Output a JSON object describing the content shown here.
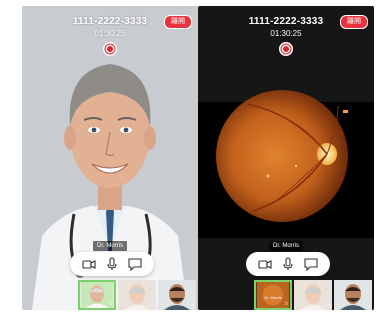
{
  "screens": [
    {
      "call_number": "1111-2222-3333",
      "call_time": "01:30:25",
      "leave_label": "離開",
      "participant_name": "Dr. Morris",
      "thumbnails": [
        {
          "kind": "patient",
          "caption": "",
          "selected": true
        },
        {
          "kind": "elderly",
          "caption": "",
          "selected": false
        },
        {
          "kind": "young",
          "caption": "",
          "selected": false
        }
      ]
    },
    {
      "call_number": "1111-2222-3333",
      "call_time": "01:30:25",
      "leave_label": "離開",
      "participant_name": "Dr. Morris",
      "thumbnails": [
        {
          "kind": "doctor",
          "caption": "Dr. Morris",
          "selected": true
        },
        {
          "kind": "elderly",
          "caption": "",
          "selected": false
        },
        {
          "kind": "young",
          "caption": "",
          "selected": false
        }
      ]
    }
  ],
  "icons": {
    "record": "record-icon",
    "video": "video-camera-icon",
    "mic": "microphone-icon",
    "chat": "chat-icon",
    "star": "star-icon"
  },
  "colors": {
    "leave_button": "#e8343e",
    "record_red": "#d9262f",
    "thumb_selected_border": "#7bd16b"
  },
  "glyphs": {
    "star": "☆"
  }
}
